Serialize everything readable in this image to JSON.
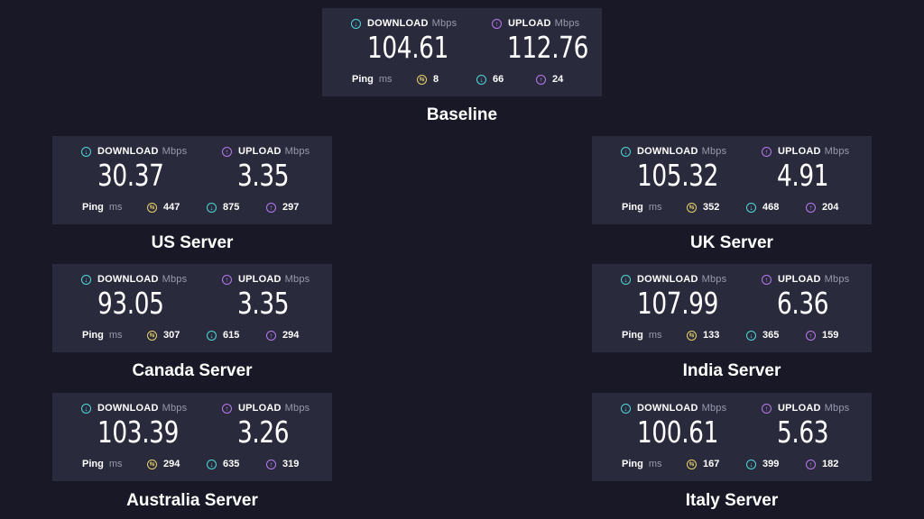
{
  "labels": {
    "download": "DOWNLOAD",
    "upload": "UPLOAD",
    "unit": "Mbps",
    "ping": "Ping",
    "ping_unit": "ms"
  },
  "icons": {
    "download": "arrow-down-circle-icon",
    "upload": "arrow-up-circle-icon",
    "ping": "ping-icon"
  },
  "colors": {
    "background": "#181827",
    "card": "#2a2a3d",
    "download": "#4fd8d6",
    "upload": "#b879ef",
    "ping": "#e8d36a"
  },
  "servers": [
    {
      "name": "Baseline",
      "download": "104.61",
      "upload": "112.76",
      "ping": "8",
      "ping_down": "66",
      "ping_up": "24"
    },
    {
      "name": "US Server",
      "download": "30.37",
      "upload": "3.35",
      "ping": "447",
      "ping_down": "875",
      "ping_up": "297"
    },
    {
      "name": "UK Server",
      "download": "105.32",
      "upload": "4.91",
      "ping": "352",
      "ping_down": "468",
      "ping_up": "204"
    },
    {
      "name": "Canada Server",
      "download": "93.05",
      "upload": "3.35",
      "ping": "307",
      "ping_down": "615",
      "ping_up": "294"
    },
    {
      "name": "India Server",
      "download": "107.99",
      "upload": "6.36",
      "ping": "133",
      "ping_down": "365",
      "ping_up": "159"
    },
    {
      "name": "Australia Server",
      "download": "103.39",
      "upload": "3.26",
      "ping": "294",
      "ping_down": "635",
      "ping_up": "319"
    },
    {
      "name": "Italy Server",
      "download": "100.61",
      "upload": "5.63",
      "ping": "167",
      "ping_down": "399",
      "ping_up": "182"
    }
  ]
}
